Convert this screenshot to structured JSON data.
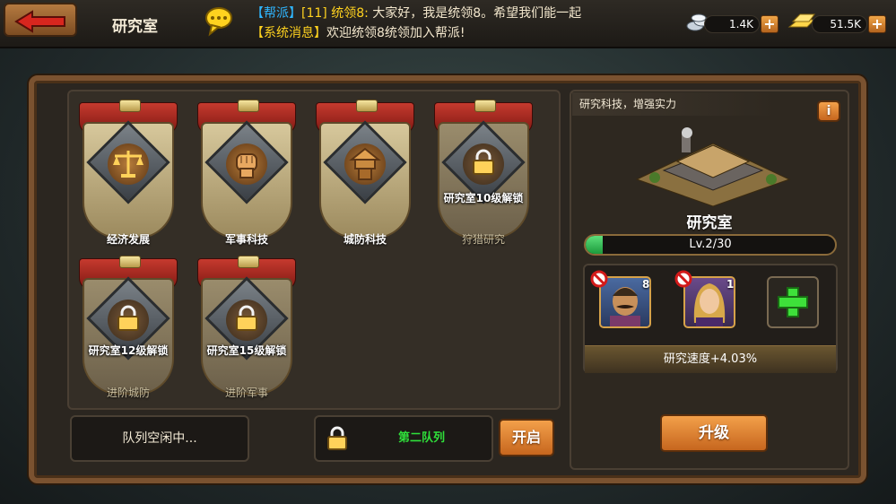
{
  "header": {
    "title": "研究室",
    "back_icon": "back-arrow-icon",
    "chat_icon": "chat-bubble-icon"
  },
  "chat": {
    "line1": {
      "tag": "【帮派】",
      "sender": "[11] 统领8:",
      "message": "大家好，我是统领8。希望我们能一起"
    },
    "line2": {
      "tag": "【系统消息】",
      "message": "欢迎统领8统领加入帮派!"
    }
  },
  "currency": {
    "silver": {
      "value": "1.4K",
      "icon": "silver-coins-icon"
    },
    "gold": {
      "value": "51.5K",
      "icon": "gold-bars-icon"
    },
    "plus_label": "+"
  },
  "research": {
    "cards": [
      {
        "label": "经济发展",
        "locked": false,
        "icon": "scales-icon"
      },
      {
        "label": "军事科技",
        "locked": false,
        "icon": "fist-icon"
      },
      {
        "label": "城防科技",
        "locked": false,
        "icon": "watchtower-icon"
      },
      {
        "label": "狩猎研究",
        "locked": true,
        "lock_text": "研究室10级解锁",
        "icon": "lock-icon"
      },
      {
        "label": "进阶城防",
        "locked": true,
        "lock_text": "研究室12级解锁",
        "icon": "lock-icon"
      },
      {
        "label": "进阶军事",
        "locked": true,
        "lock_text": "研究室15级解锁",
        "icon": "lock-icon"
      }
    ]
  },
  "queues": {
    "queue1_text": "队列空闲中...",
    "queue2_text": "第二队列",
    "open_label": "开启"
  },
  "panel": {
    "description": "研究科技，增强实力",
    "info_label": "i",
    "building_name": "研究室",
    "level_text": "Lv.2/30",
    "level_progress": 0.067,
    "heroes": [
      {
        "level": "8",
        "icon": "hero-mustache-portrait"
      },
      {
        "level": "1",
        "icon": "hero-blonde-portrait"
      }
    ],
    "speed_text": "研究速度+4.03%",
    "upgrade_label": "升级"
  }
}
